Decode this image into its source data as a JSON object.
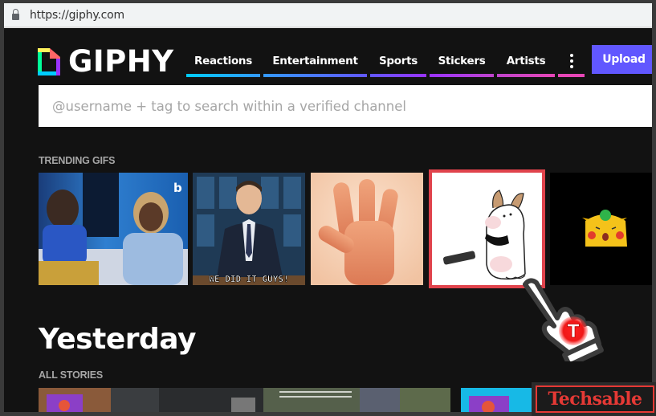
{
  "browser": {
    "url": "https://giphy.com",
    "lock_icon": "lock-icon"
  },
  "header": {
    "logo_text": "GIPHY",
    "nav": [
      {
        "label": "Reactions",
        "color_from": "#00ccff",
        "color_to": "#3399ff"
      },
      {
        "label": "Entertainment",
        "color_from": "#3399ff",
        "color_to": "#6157ff"
      },
      {
        "label": "Sports",
        "color_from": "#6157ff",
        "color_to": "#9933ff"
      },
      {
        "label": "Stickers",
        "color_from": "#9933ff",
        "color_to": "#cc44cc"
      },
      {
        "label": "Artists",
        "color_from": "#cc44cc",
        "color_to": "#e646b6"
      }
    ],
    "more_icon": "more-vertical-icon",
    "upload_label": "Upload",
    "upload_color": "#6157ff"
  },
  "search": {
    "placeholder": "@username + tag to search within a verified channel",
    "value": ""
  },
  "trending": {
    "label": "TRENDING GIFS",
    "gifs": [
      {
        "description": "Two women laughing on a blue-lit set",
        "badge": "b"
      },
      {
        "description": "Man at desk with caption",
        "caption": "WE DID IT GUYS!"
      },
      {
        "description": "Peach-colored 3D hand waving"
      },
      {
        "description": "Cartoon dog with remote control",
        "selected": true
      },
      {
        "description": "Surprised Pikachu on black background"
      }
    ]
  },
  "yesterday": {
    "title": "Yesterday",
    "stories_label": "ALL STORIES"
  },
  "overlay": {
    "cursor_icon": "pointing-hand-cursor-icon",
    "cursor_badge": "T",
    "watermark": "Techsable",
    "highlight_color": "#e0434c"
  }
}
